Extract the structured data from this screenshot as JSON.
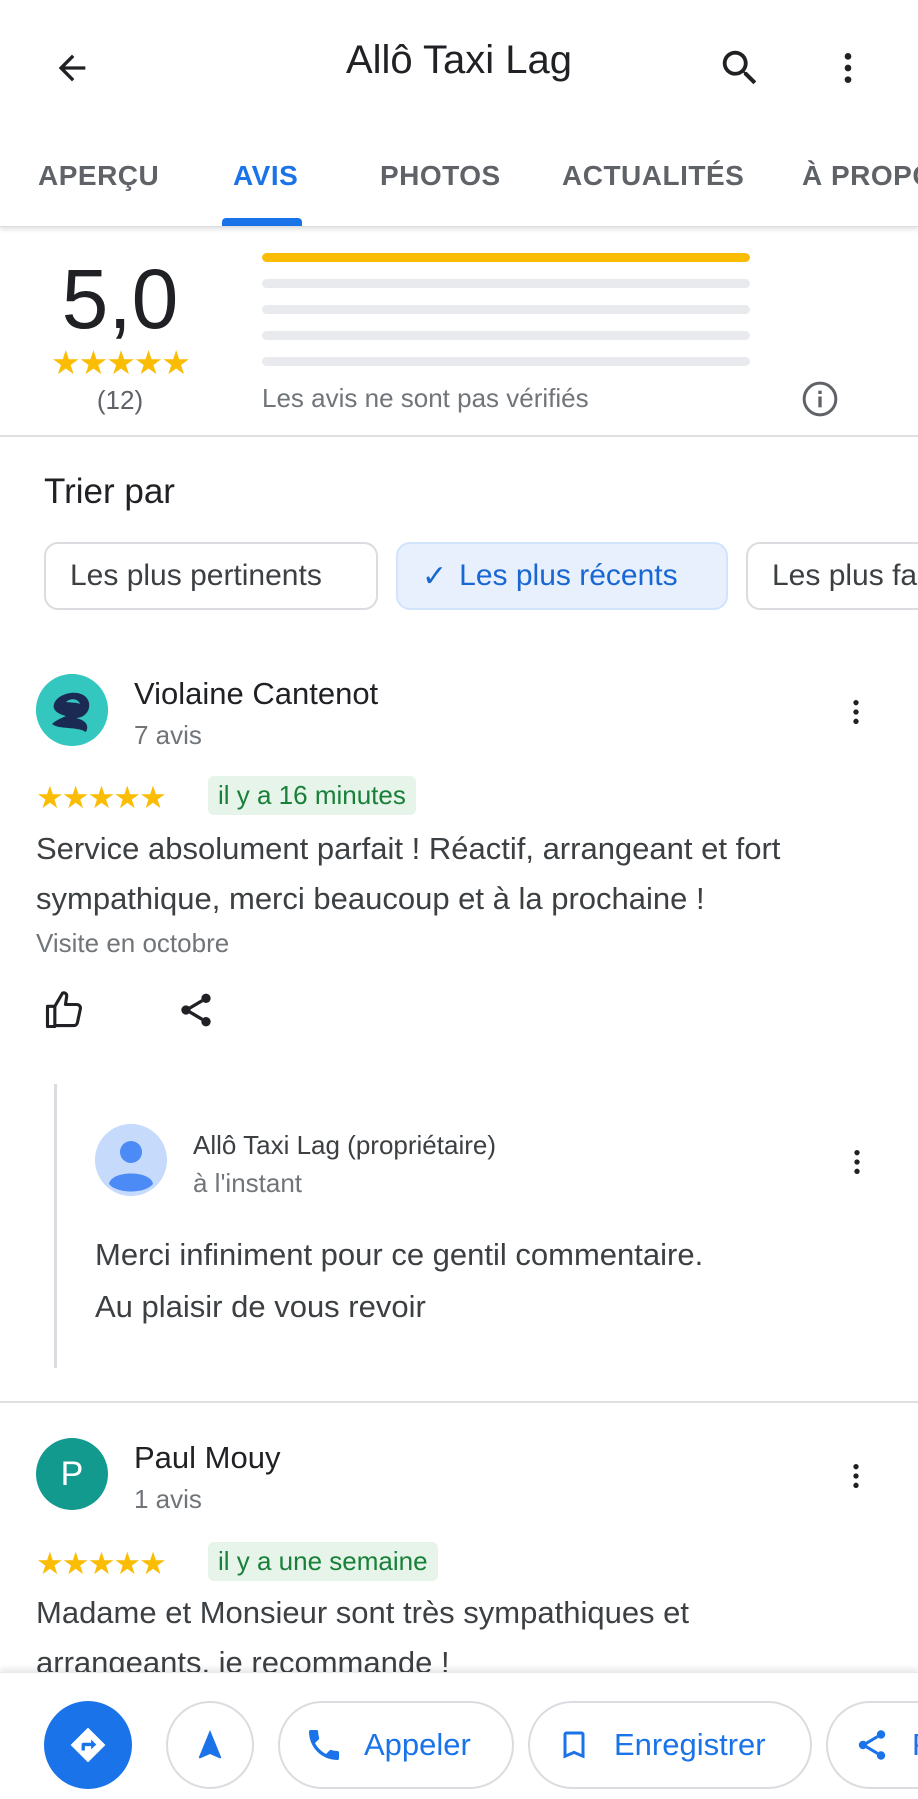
{
  "appbar": {
    "title": "Allô Taxi Lag"
  },
  "tabs": [
    {
      "label": "APERÇU"
    },
    {
      "label": "AVIS"
    },
    {
      "label": "PHOTOS"
    },
    {
      "label": "ACTUALITÉS"
    },
    {
      "label": "À PROPC"
    }
  ],
  "summary": {
    "rating": "5,0",
    "stars": "★★★★★",
    "count": "(12)",
    "distribution": [
      1.0,
      0,
      0,
      0,
      0
    ],
    "note": "Les avis ne sont pas vérifiés"
  },
  "sort": {
    "label": "Trier par",
    "chips": [
      {
        "label": "Les plus pertinents"
      },
      {
        "label": "Les plus récents",
        "check": "✓"
      },
      {
        "label": "Les plus fa"
      }
    ]
  },
  "reviews": [
    {
      "author": "Violaine Cantenot",
      "subtext": "7 avis",
      "stars": "★★★★★",
      "time": "il y a 16 minutes",
      "text_line1": "Service absolument parfait ! Réactif, arrangeant et fort",
      "text_line2": "sympathique, merci beaucoup et à la prochaine !",
      "visit": "Visite en octobre",
      "owner_reply": {
        "name": "Allô Taxi Lag (propriétaire)",
        "time": "à l'instant",
        "line1": "Merci infiniment pour ce gentil commentaire.",
        "line2": "Au plaisir de vous revoir"
      }
    },
    {
      "author": "Paul Mouy",
      "avatar_letter": "P",
      "subtext": "1 avis",
      "stars": "★★★★★",
      "time": "il y a une semaine",
      "text_line1": "Madame et Monsieur sont très sympathiques et",
      "text_line2": "arrangeants, je recommande !"
    }
  ],
  "bottombar": {
    "call_label": "Appeler",
    "save_label": "Enregistrer",
    "share_label": "P"
  },
  "colors": {
    "accent": "#1a73e8",
    "star": "#fbbc04",
    "badge_bg": "#e6f4ea",
    "badge_text": "#188038"
  }
}
